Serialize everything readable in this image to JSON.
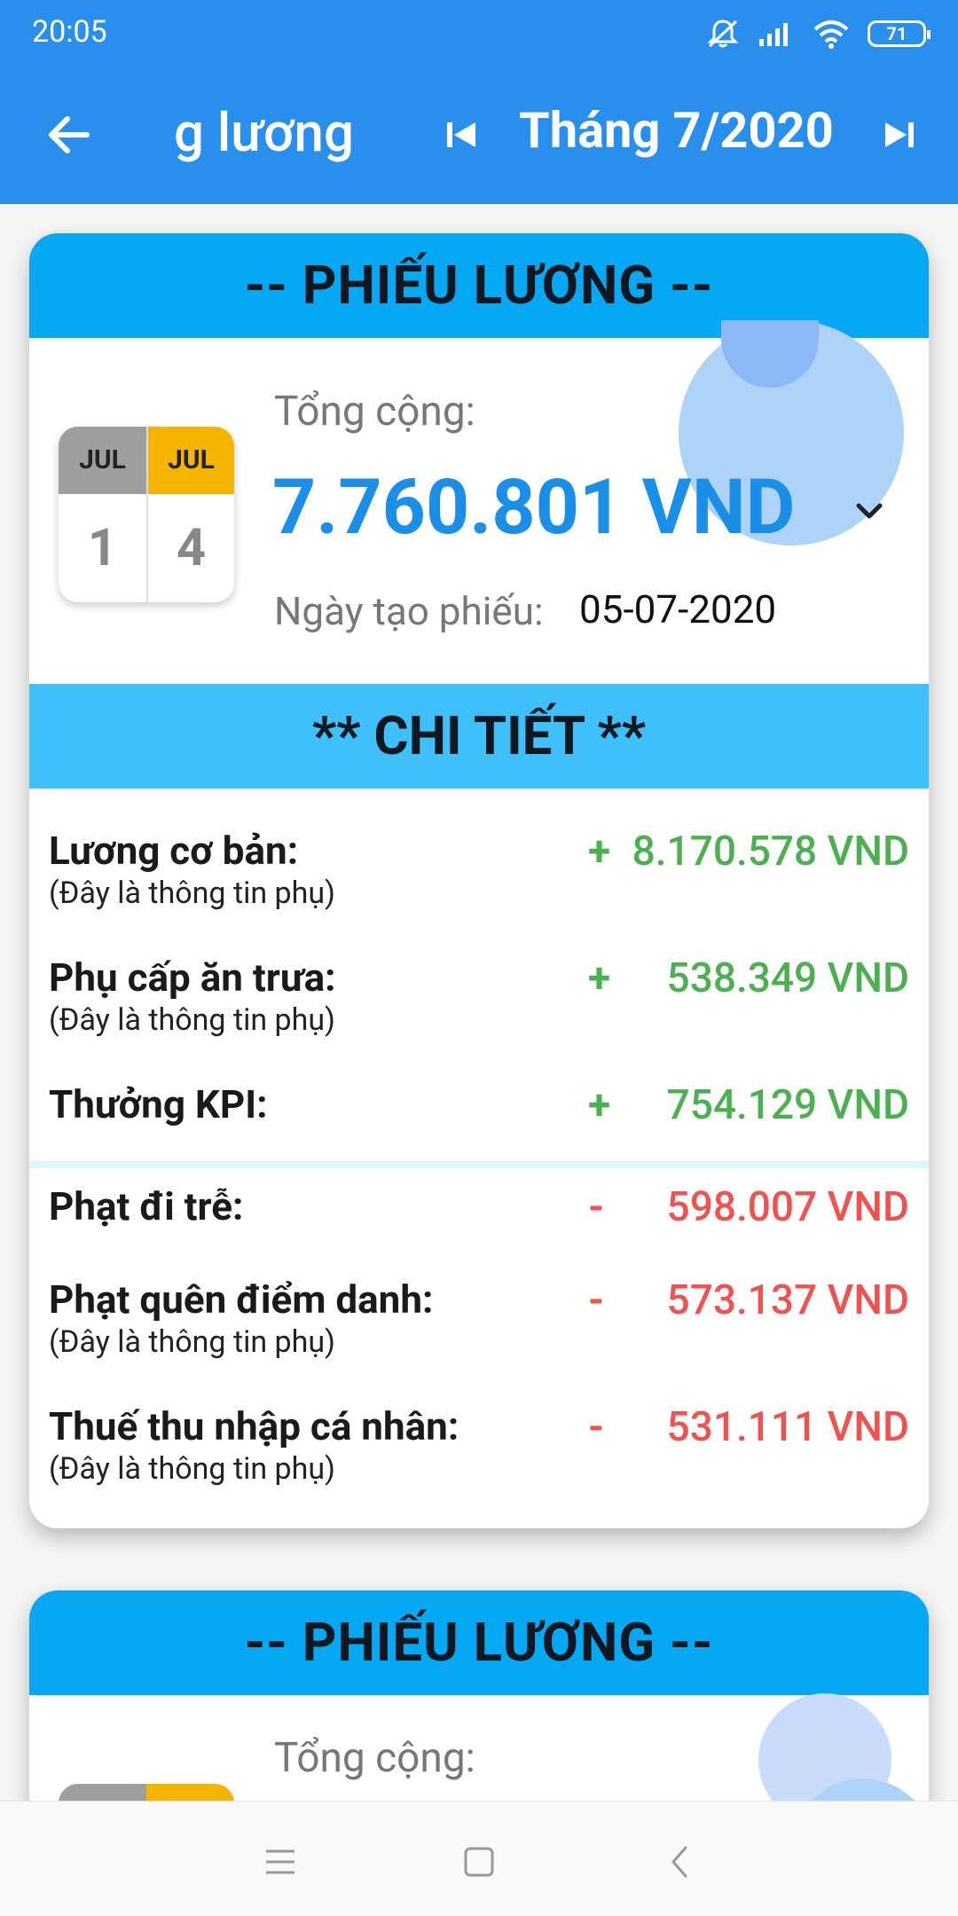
{
  "status_bar": {
    "time": "20:05",
    "battery": "71",
    "icons": [
      "mute-icon",
      "signal-icon",
      "wifi-icon",
      "battery-icon"
    ]
  },
  "app_bar": {
    "title": "g lương",
    "month": "Tháng 7/2020",
    "icons": [
      "back-arrow-icon",
      "skip-previous-icon",
      "skip-next-icon"
    ]
  },
  "colors": {
    "primary": "#2a8fec",
    "card_header": "#07a8f3",
    "detail_header": "#3fc0fb",
    "total": "#1b8fe8",
    "positive": "#4caf50",
    "negative": "#ef5350"
  },
  "payslip": {
    "header": "-- PHIẾU LƯƠNG --",
    "calendar": {
      "start_month": "JUL",
      "start_day": "1",
      "end_month": "JUL",
      "end_day": "4"
    },
    "total_label": "Tổng cộng:",
    "total_value": "7.760.801 VND",
    "created_label": "Ngày tạo phiếu:",
    "created_value": "05-07-2020",
    "detail_header": "** CHI TIẾT **",
    "items": [
      {
        "label": "Lương cơ bản:",
        "sub": "(Đây là thông tin phụ)",
        "sign": "+",
        "amount": "8.170.578 VND"
      },
      {
        "label": "Phụ cấp ăn trưa:",
        "sub": "(Đây là thông tin phụ)",
        "sign": "+",
        "amount": "538.349 VND"
      },
      {
        "label": "Thưởng KPI:",
        "sub": "",
        "sign": "+",
        "amount": "754.129 VND"
      },
      {
        "label": "Phạt đi trễ:",
        "sub": "",
        "sign": "-",
        "amount": "598.007 VND"
      },
      {
        "label": "Phạt quên điểm danh:",
        "sub": "(Đây là thông tin phụ)",
        "sign": "-",
        "amount": "573.137 VND"
      },
      {
        "label": "Thuế thu nhập cá nhân:",
        "sub": "(Đây là thông tin phụ)",
        "sign": "-",
        "amount": "531.111 VND"
      }
    ]
  },
  "payslip2": {
    "header": "-- PHIẾU LƯƠNG --",
    "total_label": "Tổng cộng:"
  },
  "nav_bar": {
    "icons": [
      "menu-icon",
      "home-icon",
      "back-icon"
    ]
  }
}
